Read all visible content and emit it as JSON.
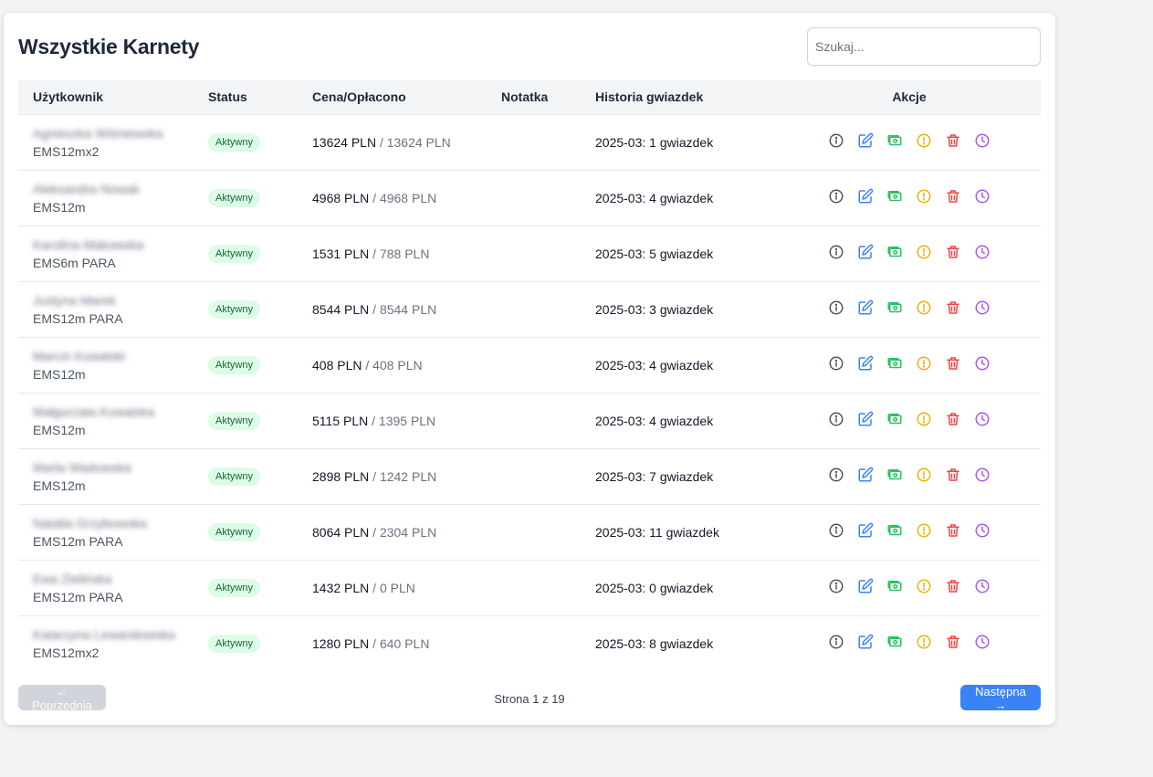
{
  "title": "Wszystkie Karnety",
  "search": {
    "placeholder": "Szukaj..."
  },
  "columns": [
    "Użytkownik",
    "Status",
    "Cena/Opłacono",
    "Notatka",
    "Historia gwiazdek",
    "Akcje"
  ],
  "colors": {
    "info": "#4b5563",
    "edit": "#3b82f6",
    "payment": "#22c55e",
    "warning": "#eab308",
    "delete": "#ef4444",
    "history": "#a855f7"
  },
  "actions": [
    "info-icon",
    "edit-icon",
    "payment-icon",
    "warning-icon",
    "delete-icon",
    "history-icon"
  ],
  "rows": [
    {
      "user": "Agnieszka Wiśniewska",
      "plan": "EMS12mx2",
      "status": "Aktywny",
      "price": "13624 PLN",
      "paid": " / 13624 PLN",
      "note": "",
      "history": "2025-03: 1 gwiazdek"
    },
    {
      "user": "Aleksandra Nowak",
      "plan": "EMS12m",
      "status": "Aktywny",
      "price": "4968 PLN",
      "paid": " / 4968 PLN",
      "note": "",
      "history": "2025-03: 4 gwiazdek"
    },
    {
      "user": "Karolina Makowska",
      "plan": "EMS6m PARA",
      "status": "Aktywny",
      "price": "1531 PLN",
      "paid": " / 788 PLN",
      "note": "",
      "history": "2025-03: 5 gwiazdek"
    },
    {
      "user": "Justyna Marek",
      "plan": "EMS12m PARA",
      "status": "Aktywny",
      "price": "8544 PLN",
      "paid": " / 8544 PLN",
      "note": "",
      "history": "2025-03: 3 gwiazdek"
    },
    {
      "user": "Marcin Kowalski",
      "plan": "EMS12m",
      "status": "Aktywny",
      "price": "408 PLN",
      "paid": " / 408 PLN",
      "note": "",
      "history": "2025-03: 4 gwiazdek"
    },
    {
      "user": "Małgorzata Kowalska",
      "plan": "EMS12m",
      "status": "Aktywny",
      "price": "5115 PLN",
      "paid": " / 1395 PLN",
      "note": "",
      "history": "2025-03: 4 gwiazdek"
    },
    {
      "user": "Marta Wadowska",
      "plan": "EMS12m",
      "status": "Aktywny",
      "price": "2898 PLN",
      "paid": " / 1242 PLN",
      "note": "",
      "history": "2025-03: 7 gwiazdek"
    },
    {
      "user": "Natalia Grzybowska",
      "plan": "EMS12m PARA",
      "status": "Aktywny",
      "price": "8064 PLN",
      "paid": " / 2304 PLN",
      "note": "",
      "history": "2025-03: 11 gwiazdek"
    },
    {
      "user": "Ewa Zielińska",
      "plan": "EMS12m PARA",
      "status": "Aktywny",
      "price": "1432 PLN",
      "paid": " / 0 PLN",
      "note": "",
      "history": "2025-03: 0 gwiazdek"
    },
    {
      "user": "Katarzyna Lewandowska",
      "plan": "EMS12mx2",
      "status": "Aktywny",
      "price": "1280 PLN",
      "paid": " / 640 PLN",
      "note": "",
      "history": "2025-03: 8 gwiazdek"
    }
  ],
  "pagination": {
    "prev": "← Poprzednia",
    "next": "Następna →",
    "info": "Strona 1 z 19"
  }
}
